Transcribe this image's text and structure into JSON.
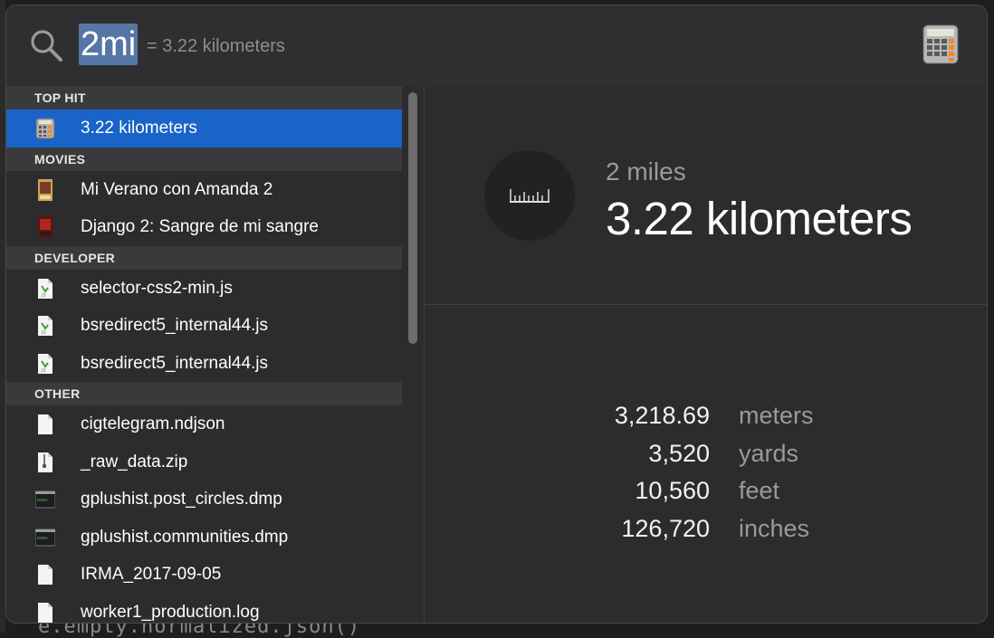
{
  "search": {
    "query": "2mi",
    "suggestion": "= 3.22 kilometers"
  },
  "sections": [
    {
      "header": "TOP HIT",
      "items": [
        {
          "label": "3.22 kilometers",
          "icon": "calculator-icon",
          "selected": true
        }
      ]
    },
    {
      "header": "MOVIES",
      "items": [
        {
          "label": "Mi Verano con Amanda 2",
          "icon": "movie-poster-icon"
        },
        {
          "label": "Django 2: Sangre de mi sangre",
          "icon": "movie-poster-icon"
        }
      ]
    },
    {
      "header": "DEVELOPER",
      "items": [
        {
          "label": "selector-css2-min.js",
          "icon": "js-file-icon"
        },
        {
          "label": "bsredirect5_internal44.js",
          "icon": "js-file-icon"
        },
        {
          "label": "bsredirect5_internal44.js",
          "icon": "js-file-icon"
        }
      ]
    },
    {
      "header": "OTHER",
      "items": [
        {
          "label": "cigtelegram.ndjson",
          "icon": "document-icon"
        },
        {
          "label": "_raw_data.zip",
          "icon": "zip-file-icon"
        },
        {
          "label": "gplushist.post_circles.dmp",
          "icon": "terminal-file-icon"
        },
        {
          "label": "gplushist.communities.dmp",
          "icon": "terminal-file-icon"
        },
        {
          "label": "IRMA_2017-09-05",
          "icon": "document-icon"
        },
        {
          "label": "worker1_production.log",
          "icon": "document-icon"
        }
      ]
    }
  ],
  "preview": {
    "from": "2 miles",
    "to": "3.22 kilometers",
    "conversions": [
      {
        "value": "3,218.69",
        "unit": "meters"
      },
      {
        "value": "3,520",
        "unit": "yards"
      },
      {
        "value": "10,560",
        "unit": "feet"
      },
      {
        "value": "126,720",
        "unit": "inches"
      }
    ]
  },
  "background": {
    "code_text": "e.empty.normalized.json()"
  },
  "colors": {
    "selection": "#1a63c8",
    "query_highlight": "#5677a5",
    "panel": "#2c2c2e"
  }
}
